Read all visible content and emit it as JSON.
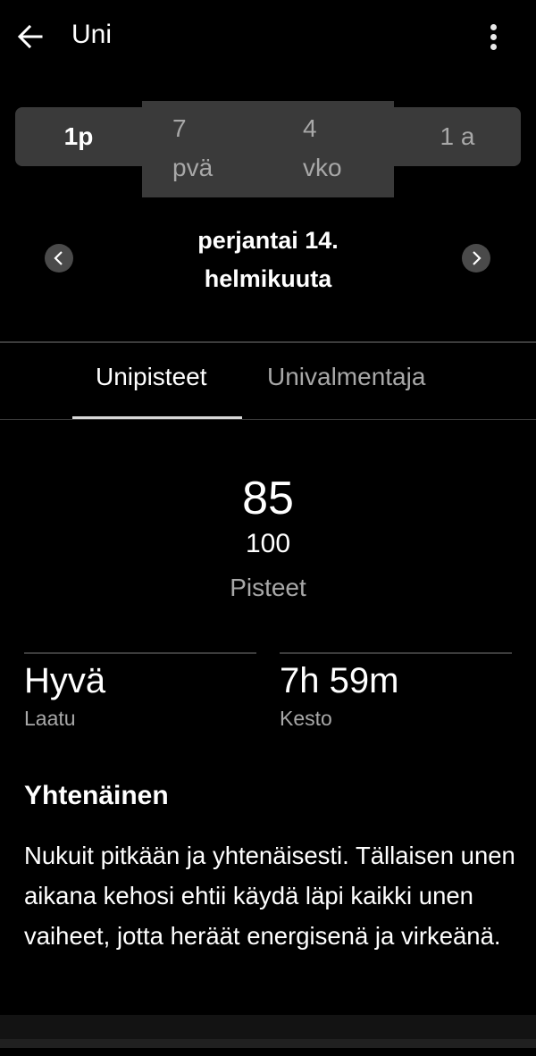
{
  "app_bar": {
    "title": "Uni",
    "back_icon": "arrow-left-icon",
    "menu_icon": "more-vertical-icon"
  },
  "period_selector": {
    "options": [
      {
        "line1": "1p",
        "line2": "",
        "selected": true
      },
      {
        "line1": "7",
        "line2": "pvä",
        "selected": false
      },
      {
        "line1": "4",
        "line2": "vko",
        "selected": false
      },
      {
        "line1": "1 a",
        "line2": "",
        "selected": false
      }
    ]
  },
  "date_nav": {
    "line1": "perjantai 14.",
    "line2": "helmikuuta",
    "prev_icon": "chevron-left-icon",
    "next_icon": "chevron-right-icon"
  },
  "tabs": [
    {
      "label": "Unipisteet",
      "active": true
    },
    {
      "label": "Univalmentaja",
      "active": false
    }
  ],
  "score": {
    "value": "85",
    "max": "100",
    "label": "Pisteet"
  },
  "stats": [
    {
      "value": "Hyvä",
      "label": "Laatu"
    },
    {
      "value": "7h 59m",
      "label": "Kesto"
    }
  ],
  "summary": {
    "title": "Yhtenäinen",
    "text": "Nukuit pitkään ja yhtenäisesti. Tällaisen unen aikana kehosi ehtii käydä läpi kaikki unen vaiheet, jotta heräät energisenä ja virkeänä."
  },
  "colors": {
    "background": "#000000",
    "segment_bg": "#3a3a3a",
    "inactive_text": "#a8a8a8",
    "divider": "#3c3c3c"
  }
}
